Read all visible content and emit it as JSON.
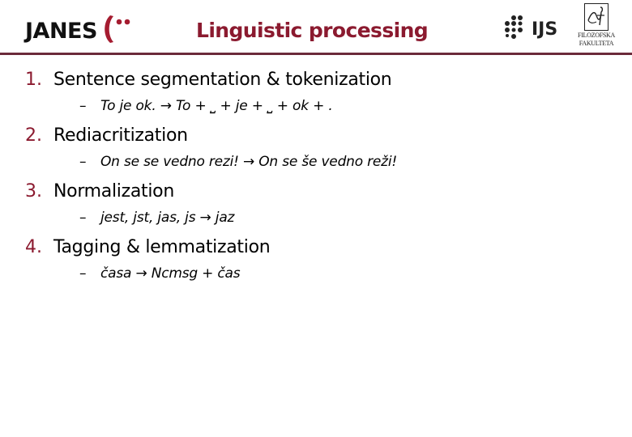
{
  "header": {
    "logo_left_text": "JANES",
    "title": "Linguistic processing",
    "logo_right_ijs_text": "IJS",
    "logo_right_ff_text_line1": "FILOZOFSKA",
    "logo_right_ff_text_line2": "FAKULTETA"
  },
  "colors": {
    "accent": "#8b1a2f",
    "rule": "#6b2a3a",
    "text": "#000000"
  },
  "items": [
    {
      "number": "1.",
      "label": "Sentence segmentation & tokenization",
      "bullet": "–",
      "example": "To je ok.  → To + ⎵ + je + ⎵ + ok + ."
    },
    {
      "number": "2.",
      "label": "Rediacritization",
      "bullet": "–",
      "example": "On se se vedno rezi! → On se še vedno reži!"
    },
    {
      "number": "3.",
      "label": "Normalization",
      "bullet": "–",
      "example": "jest, jst, jas, js → jaz"
    },
    {
      "number": "4.",
      "label": "Tagging & lemmatization",
      "bullet": "–",
      "example": "časa → Ncmsg + čas"
    }
  ]
}
